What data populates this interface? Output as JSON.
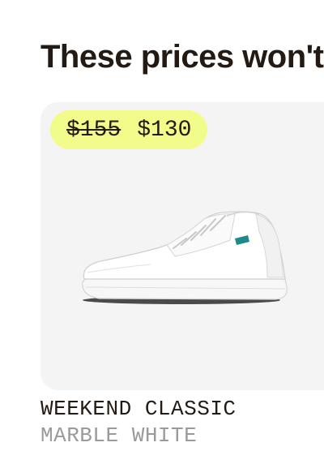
{
  "section": {
    "heading": "These prices won't"
  },
  "product": {
    "price_original": "$155",
    "price_sale": "$130",
    "name": "WEEKEND CLASSIC",
    "variant": "MARBLE WHITE",
    "image_icon": "white-sneaker-illustration"
  },
  "colors": {
    "badge": "#f2fc8a",
    "card_background": "#f4f4f4",
    "heading_text": "#231a14",
    "variant_text": "#9a9a9a",
    "accent": "#1f8a8c"
  }
}
